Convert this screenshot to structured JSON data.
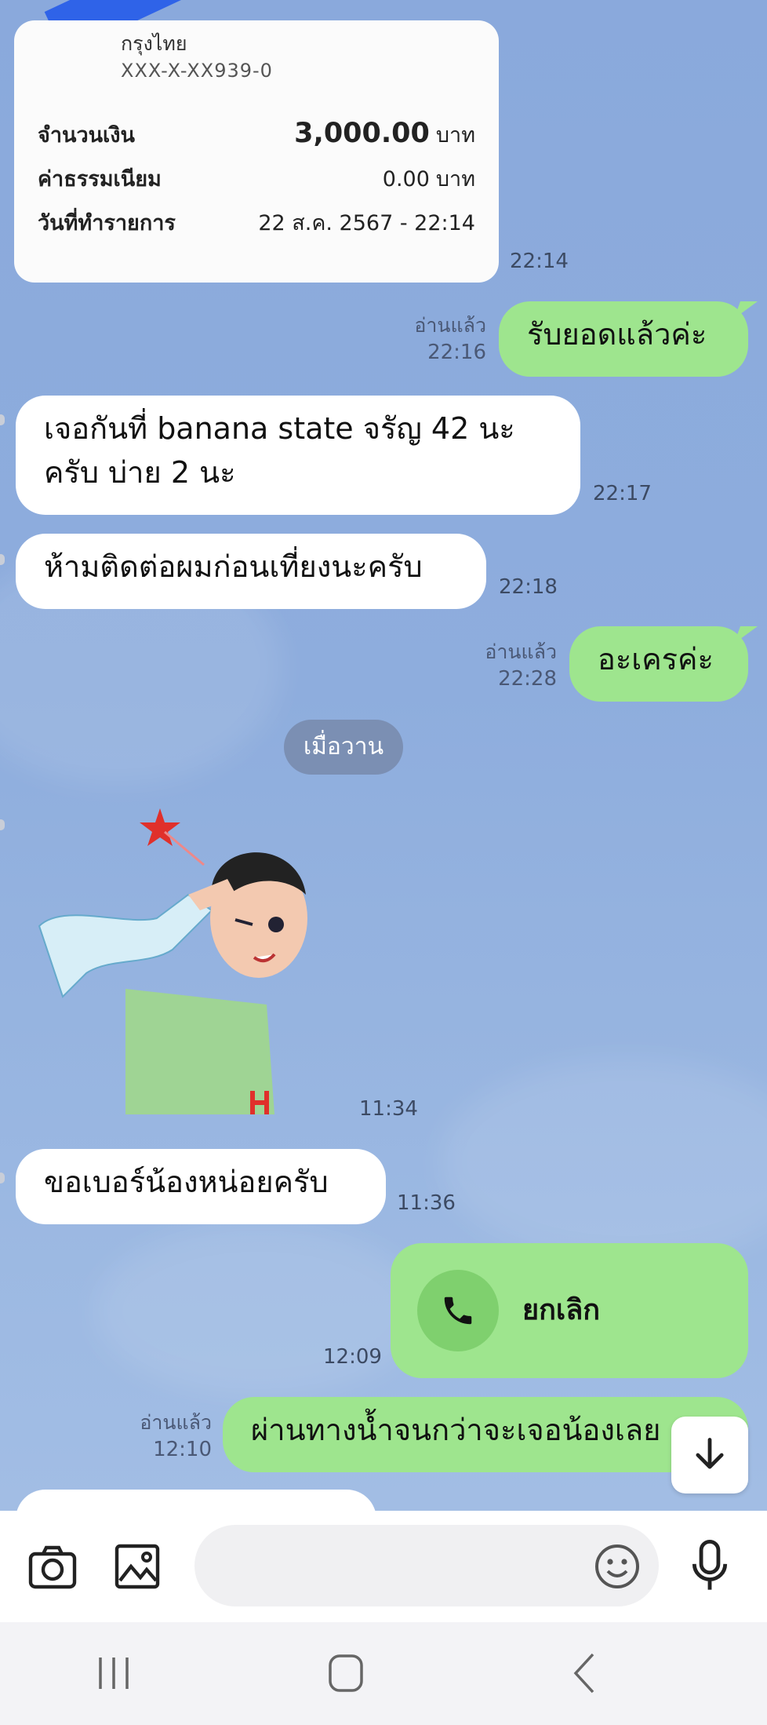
{
  "receipt": {
    "bank": "กรุงไทย",
    "account": "XXX-X-XX939-0",
    "amount_label": "จำนวนเงิน",
    "amount_value": "3,000.00",
    "amount_unit": "บาท",
    "fee_label": "ค่าธรรมเนียม",
    "fee_value": "0.00",
    "fee_unit": "บาท",
    "date_label": "วันที่ทำรายการ",
    "date_value": "22 ส.ค. 2567 - 22:14",
    "time": "22:14"
  },
  "messages": [
    {
      "dir": "out",
      "text": "รับยอดแล้วค่ะ",
      "read": "อ่านแล้ว",
      "time": "22:16"
    },
    {
      "dir": "in",
      "text": "เจอกันที่ banana state จรัญ 42 นะ",
      "text2": "ครับ บ่าย 2 นะ",
      "time": "22:17"
    },
    {
      "dir": "in",
      "text": "ห้ามติดต่อผมก่อนเที่ยงนะครับ",
      "time": "22:18"
    },
    {
      "dir": "out",
      "text": "อะเครค่ะ",
      "read": "อ่านแล้ว",
      "time": "22:28"
    },
    {
      "dir": "sticker",
      "time": "11:34"
    },
    {
      "dir": "in",
      "text": "ขอเบอร์น้องหน่อยครับ",
      "time": "11:36"
    },
    {
      "dir": "call",
      "text": "ยกเลิก",
      "time": "12:09"
    },
    {
      "dir": "out",
      "text": "ผ่านทางน้ำจนกว่าจะเจอน้องเลย",
      "read": "อ่านแล้ว",
      "time": "12:10"
    }
  ],
  "date_separator": "เมื่อวาน",
  "input": {
    "placeholder": ""
  },
  "icons": {
    "camera": "camera-icon",
    "gallery": "image-icon",
    "emoji": "emoji-icon",
    "mic": "microphone-icon",
    "scroll": "arrow-down-icon",
    "call": "phone-icon"
  },
  "colors": {
    "out_bubble": "#9ee58e",
    "in_bubble": "#ffffff",
    "bg": "#8eaddd"
  }
}
